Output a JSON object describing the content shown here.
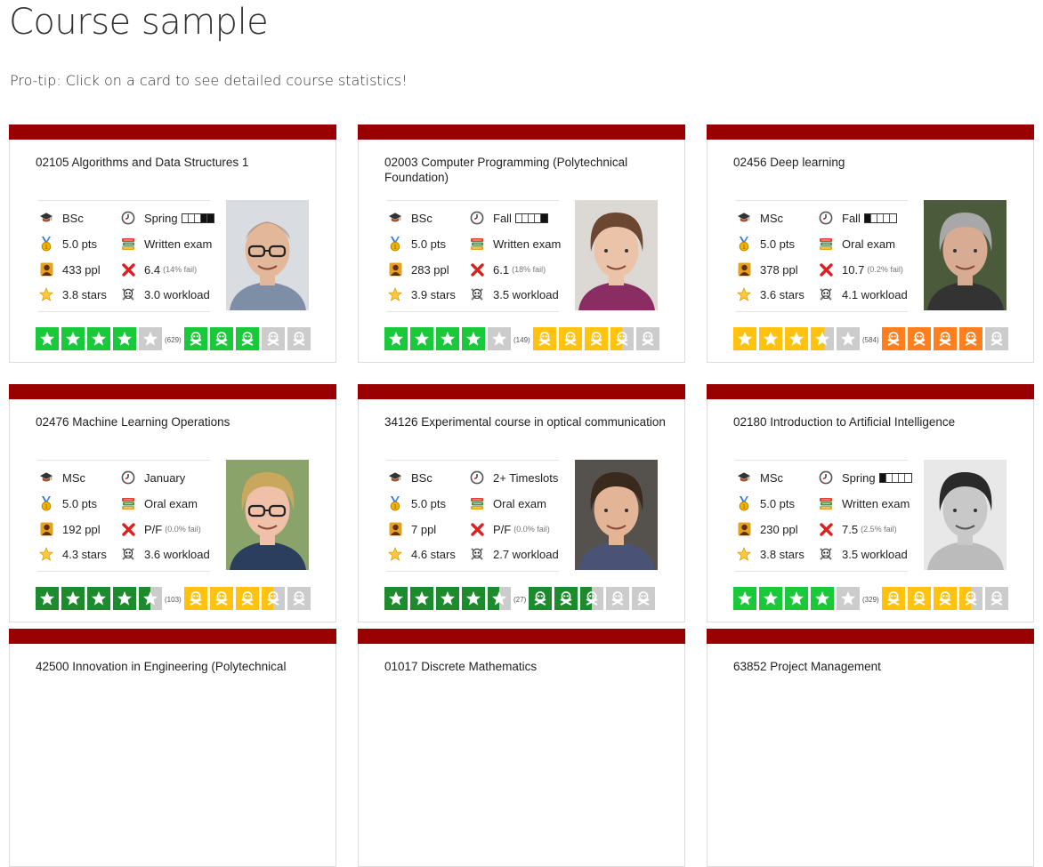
{
  "page": {
    "title": "Course sample",
    "protip": "Pro-tip: Click on a card to see detailed course statistics!"
  },
  "colors": {
    "card_bar": "#990000",
    "green_bright": "#19c93a",
    "green_dark": "#1e8a2e",
    "yellow": "#ffc20e",
    "orange": "#ff7f1e",
    "grey": "#cccccc"
  },
  "icons": {
    "level": "mortarboard-icon",
    "season": "clock-icon",
    "ects": "medal-icon",
    "exam": "books-icon",
    "participants": "person-icon",
    "grade": "cross-mark-icon",
    "stars": "star-icon",
    "workload": "skull-icon"
  },
  "cards": [
    {
      "title": "02105 Algorithms and Data Structures 1",
      "level": "BSc",
      "season": "Spring",
      "semester_grid": [
        0,
        0,
        0,
        1,
        1
      ],
      "ects": "5.0 pts",
      "exam": "Written exam",
      "participants": "433 ppl",
      "grade": "6.4",
      "fail_rate": "(14% fail)",
      "stars": "3.8 stars",
      "workload": "3.0 workload",
      "rating_count": "(629)",
      "star_fill": 4,
      "star_color": "#19c93a",
      "skull_fill": 3,
      "skull_color": "#19c93a",
      "photo": {
        "bg": "#d9dde2",
        "hair": "#7a5a3c",
        "skin": "#e2b79a",
        "shirt": "#7e8ea6",
        "glasses": true,
        "bald": true
      }
    },
    {
      "title": "02003 Computer Programming (Polytechnical Foundation)",
      "level": "BSc",
      "season": "Fall",
      "semester_grid": [
        0,
        0,
        0,
        0,
        1
      ],
      "ects": "5.0 pts",
      "exam": "Written exam",
      "participants": "283 ppl",
      "grade": "6.1",
      "fail_rate": "(18% fail)",
      "stars": "3.9 stars",
      "workload": "3.5 workload",
      "rating_count": "(149)",
      "star_fill": 4,
      "star_color": "#19c93a",
      "skull_fill": 3.5,
      "skull_color": "#ffc20e",
      "photo": {
        "bg": "#dcd9d5",
        "hair": "#6b4630",
        "skin": "#eac3a8",
        "shirt": "#8a2d63",
        "glasses": false,
        "bald": false
      }
    },
    {
      "title": "02456 Deep learning",
      "level": "MSc",
      "season": "Fall",
      "semester_grid": [
        1,
        0,
        0,
        0,
        0
      ],
      "ects": "5.0 pts",
      "exam": "Oral exam",
      "participants": "378 ppl",
      "grade": "10.7",
      "fail_rate": "(0.2% fail)",
      "stars": "3.6 stars",
      "workload": "4.1 workload",
      "rating_count": "(584)",
      "star_fill": 3.6,
      "star_color": "#ffc20e",
      "skull_fill": 4,
      "skull_color": "#ff7f1e",
      "photo": {
        "bg": "#4a5a3a",
        "hair": "#a8a8a8",
        "skin": "#d8ab93",
        "shirt": "#333333",
        "glasses": false,
        "bald": false
      }
    },
    {
      "title": "02476 Machine Learning Operations",
      "level": "MSc",
      "season": "January",
      "semester_grid": [],
      "ects": "5.0 pts",
      "exam": "Oral exam",
      "participants": "192 ppl",
      "grade": "P/F",
      "fail_rate": "(0.0% fail)",
      "stars": "4.3 stars",
      "workload": "3.6 workload",
      "rating_count": "(103)",
      "star_fill": 4.5,
      "star_color": "#1e8a2e",
      "skull_fill": 3.5,
      "skull_color": "#ffc20e",
      "photo": {
        "bg": "#8aa36b",
        "hair": "#c9a85e",
        "skin": "#f0c0a8",
        "shirt": "#2c3e5e",
        "glasses": true,
        "bald": false
      }
    },
    {
      "title": "34126 Experimental course in optical communication",
      "level": "BSc",
      "season": "2+ Timeslots",
      "semester_grid": [],
      "ects": "5.0 pts",
      "exam": "Oral exam",
      "participants": "7 ppl",
      "grade": "P/F",
      "fail_rate": "(0.0% fail)",
      "stars": "4.6 stars",
      "workload": "2.7 workload",
      "rating_count": "(27)",
      "star_fill": 4.5,
      "star_color": "#1e8a2e",
      "skull_fill": 2.5,
      "skull_color": "#1e8a2e",
      "photo": {
        "bg": "#55524d",
        "hair": "#3a2a1e",
        "skin": "#e3b496",
        "shirt": "#4a5275",
        "glasses": false,
        "bald": false
      }
    },
    {
      "title": "02180 Introduction to Artificial Intelligence",
      "level": "MSc",
      "season": "Spring",
      "semester_grid": [
        1,
        0,
        0,
        0,
        0
      ],
      "ects": "5.0 pts",
      "exam": "Written exam",
      "participants": "230 ppl",
      "grade": "7.5",
      "fail_rate": "(2.5% fail)",
      "stars": "3.8 stars",
      "workload": "3.5 workload",
      "rating_count": "(329)",
      "star_fill": 4,
      "star_color": "#19c93a",
      "skull_fill": 3.5,
      "skull_color": "#ffc20e",
      "photo": {
        "bg": "#e8e8e8",
        "hair": "#2a2a2a",
        "skin": "#c8c8c8",
        "shirt": "#bbbbbb",
        "glasses": false,
        "bald": false,
        "grayscale": true
      }
    },
    {
      "title": "42500 Innovation in Engineering (Polytechnical"
    },
    {
      "title": "01017 Discrete Mathematics"
    },
    {
      "title": "63852 Project Management"
    }
  ]
}
